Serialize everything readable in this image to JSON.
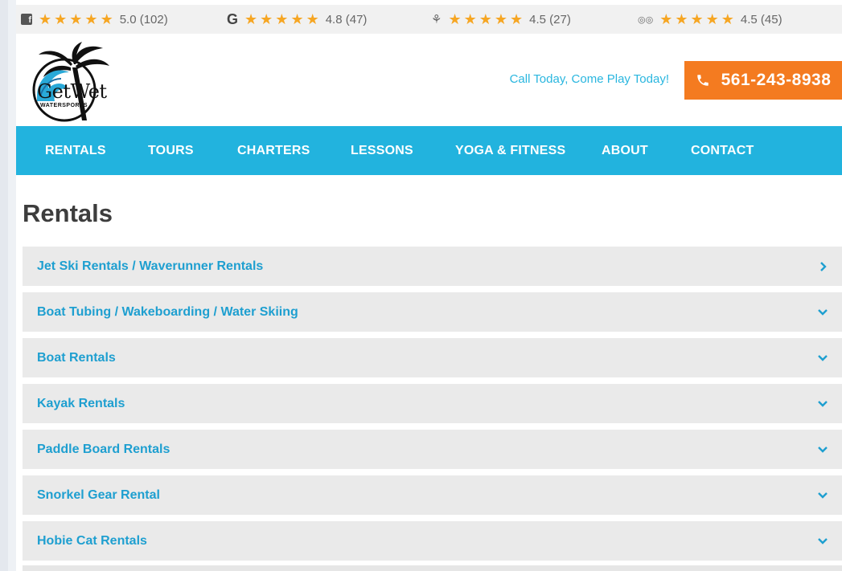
{
  "ratings": [
    {
      "source_icon": "facebook-icon",
      "source_glyph": "f",
      "stars": 5,
      "score": "5.0 (102)"
    },
    {
      "source_icon": "google-icon",
      "source_glyph": "G",
      "stars": 5,
      "score": "4.8 (47)"
    },
    {
      "source_icon": "yelp-icon",
      "source_glyph": "⚘",
      "stars": 5,
      "score": "4.5 (27)"
    },
    {
      "source_icon": "tripadvisor-icon",
      "source_glyph": "◎◎",
      "stars": 5,
      "score": "4.5 (45)"
    }
  ],
  "header": {
    "logo_text": "GetWet",
    "logo_subtext": "WATERSPORTS",
    "tagline": "Call Today, Come Play Today!",
    "phone": "561-243-8938",
    "phone_icon": "phone-icon"
  },
  "nav": {
    "items": [
      "RENTALS",
      "TOURS",
      "CHARTERS",
      "LESSONS",
      "YOGA & FITNESS",
      "ABOUT",
      "CONTACT"
    ]
  },
  "main": {
    "title": "Rentals",
    "accordion": [
      {
        "label": "Jet Ski Rentals / Waverunner Rentals",
        "chevron": "›",
        "chevron_icon": "chevron-right-icon"
      },
      {
        "label": "Boat Tubing / Wakeboarding / Water Skiing",
        "chevron": "⌄",
        "chevron_icon": "chevron-down-icon"
      },
      {
        "label": "Boat Rentals",
        "chevron": "⌄",
        "chevron_icon": "chevron-down-icon"
      },
      {
        "label": "Kayak Rentals",
        "chevron": "⌄",
        "chevron_icon": "chevron-down-icon"
      },
      {
        "label": "Paddle Board Rentals",
        "chevron": "⌄",
        "chevron_icon": "chevron-down-icon"
      },
      {
        "label": "Snorkel Gear Rental",
        "chevron": "⌄",
        "chevron_icon": "chevron-down-icon"
      },
      {
        "label": "Hobie Cat Rentals",
        "chevron": "⌄",
        "chevron_icon": "chevron-down-icon"
      }
    ]
  },
  "colors": {
    "accent": "#22b3de",
    "link": "#1e9fd0",
    "cta": "#f47b20",
    "star": "#f6a623"
  }
}
